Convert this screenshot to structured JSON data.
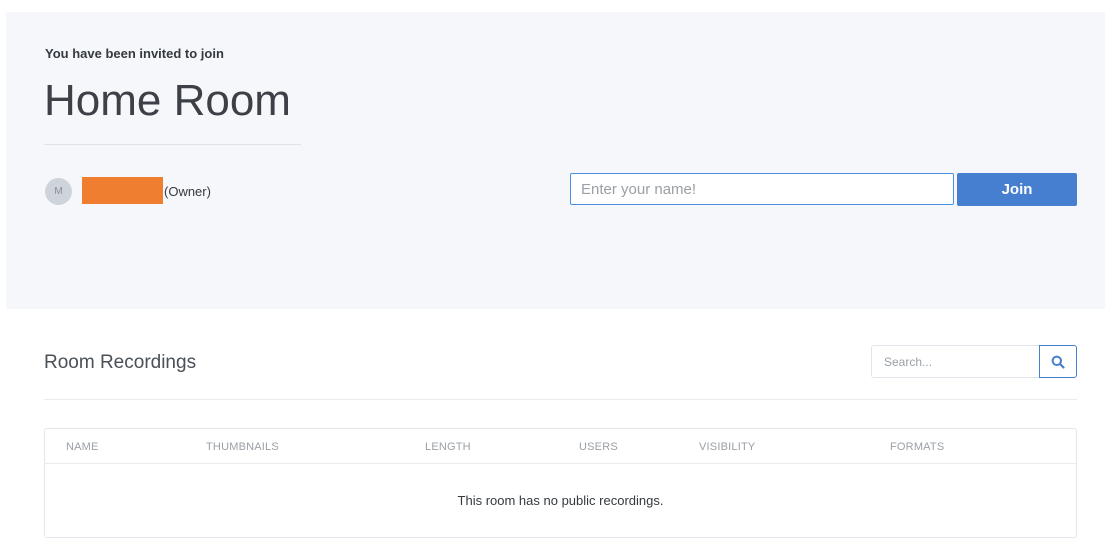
{
  "invite": {
    "message": "You have been invited to join",
    "room_name": "Home Room"
  },
  "owner": {
    "avatar_initial": "M",
    "role_label": "(Owner)"
  },
  "join_form": {
    "name_placeholder": "Enter your name!",
    "join_label": "Join"
  },
  "recordings": {
    "title": "Room Recordings",
    "search_placeholder": "Search...",
    "columns": [
      "NAME",
      "THUMBNAILS",
      "LENGTH",
      "USERS",
      "VISIBILITY",
      "FORMATS"
    ],
    "empty_message": "This room has no public recordings."
  },
  "colors": {
    "primary": "#467fcf",
    "hero_background": "#f5f7fb",
    "redaction": "#ef7e31"
  },
  "icons": {
    "search_button": "search-icon"
  }
}
